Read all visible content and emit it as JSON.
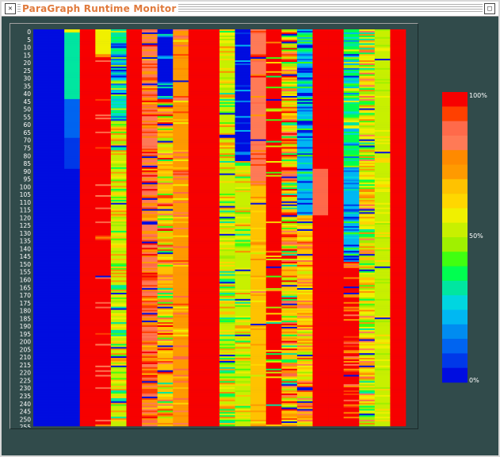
{
  "window": {
    "title": "ParaGraph Runtime Monitor",
    "close_glyph": "✕",
    "maximize_glyph": "□"
  },
  "chart_data": {
    "type": "heatmap",
    "title": "",
    "xlabel": "",
    "ylabel": "",
    "y_tick_labels": [
      "0",
      "5",
      "10",
      "15",
      "20",
      "25",
      "30",
      "35",
      "40",
      "45",
      "50",
      "55",
      "60",
      "65",
      "70",
      "75",
      "80",
      "85",
      "90",
      "95",
      "100",
      "105",
      "110",
      "115",
      "120",
      "125",
      "130",
      "135",
      "140",
      "145",
      "150",
      "155",
      "160",
      "165",
      "170",
      "175",
      "180",
      "185",
      "190",
      "195",
      "200",
      "205",
      "210",
      "215",
      "220",
      "225",
      "230",
      "235",
      "240",
      "245",
      "250",
      "255"
    ],
    "row_count": 256,
    "column_count": 20,
    "value_range": [
      0,
      100
    ],
    "unit": "%",
    "colorbar": {
      "labels": [
        "100%",
        "50%",
        "0%"
      ],
      "colors_top_to_bottom": [
        "#f70000",
        "#ff4000",
        "#ff6a4a",
        "#ff7a56",
        "#ff8a00",
        "#ff9a00",
        "#ffc200",
        "#ffd700",
        "#f0f000",
        "#c8f000",
        "#a0f000",
        "#40ff10",
        "#00ff50",
        "#00e6a0",
        "#00d6e0",
        "#00b8f2",
        "#008cf0",
        "#0064f0",
        "#0038e8",
        "#000de0"
      ]
    },
    "columns": [
      {
        "segments": [
          [
            0,
            256,
            0
          ]
        ]
      },
      {
        "segments": [
          [
            0,
            256,
            0
          ]
        ]
      },
      {
        "segments": [
          [
            0,
            2,
            60
          ],
          [
            2,
            45,
            30
          ],
          [
            45,
            70,
            10
          ],
          [
            70,
            90,
            5
          ],
          [
            90,
            256,
            0
          ]
        ]
      },
      {
        "segments": [
          [
            0,
            256,
            100
          ]
        ]
      },
      {
        "segments": [
          [
            0,
            16,
            60
          ],
          [
            16,
            18,
            80
          ],
          [
            18,
            30,
            100
          ],
          [
            30,
            70,
            100
          ],
          [
            70,
            256,
            100
          ]
        ],
        "noise": {
          "level": 90,
          "spread": 12,
          "rate": 0.15
        }
      },
      {
        "segments": [
          [
            0,
            60,
            30
          ],
          [
            60,
            256,
            55
          ]
        ],
        "noise": {
          "spread": 25,
          "rate": 0.7
        }
      },
      {
        "segments": [
          [
            0,
            256,
            100
          ]
        ]
      },
      {
        "segments": [
          [
            0,
            256,
            85
          ]
        ],
        "noise": {
          "spread": 15,
          "rate": 0.85
        }
      },
      {
        "segments": [
          [
            0,
            45,
            0
          ],
          [
            45,
            256,
            68
          ]
        ],
        "noise": {
          "spread": 35,
          "rate": 0.6
        }
      },
      {
        "segments": [
          [
            0,
            256,
            75
          ]
        ],
        "noise": {
          "spread": 20,
          "rate": 0.3
        }
      },
      {
        "segments": [
          [
            0,
            256,
            100
          ]
        ]
      },
      {
        "segments": [
          [
            0,
            256,
            100
          ]
        ]
      },
      {
        "segments": [
          [
            0,
            10,
            60
          ],
          [
            10,
            256,
            55
          ]
        ],
        "noise": {
          "spread": 25,
          "rate": 0.6
        }
      },
      {
        "segments": [
          [
            0,
            85,
            0
          ],
          [
            85,
            256,
            55
          ]
        ],
        "noise": {
          "spread": 25,
          "rate": 0.5
        }
      },
      {
        "segments": [
          [
            0,
            100,
            85
          ],
          [
            100,
            256,
            70
          ]
        ],
        "noise": {
          "spread": 15,
          "rate": 0.2
        }
      },
      {
        "segments": [
          [
            0,
            256,
            100
          ]
        ],
        "noise": {
          "level": 55,
          "spread": 25,
          "rate": 0.12
        }
      },
      {
        "segments": [
          [
            0,
            256,
            70
          ]
        ],
        "noise": {
          "spread": 40,
          "rate": 0.8
        }
      },
      {
        "segments": [
          [
            0,
            120,
            20
          ],
          [
            120,
            256,
            70
          ]
        ],
        "noise": {
          "spread": 25,
          "rate": 0.6
        }
      },
      {
        "segments": [
          [
            0,
            90,
            100
          ],
          [
            90,
            120,
            90
          ],
          [
            120,
            256,
            100
          ]
        ]
      },
      {
        "segments": [
          [
            0,
            256,
            100
          ]
        ]
      },
      {
        "segments": [
          [
            0,
            90,
            35
          ],
          [
            90,
            150,
            20
          ],
          [
            150,
            256,
            100
          ]
        ],
        "noise": {
          "spread": 25,
          "rate": 0.6
        }
      },
      {
        "segments": [
          [
            0,
            256,
            60
          ]
        ],
        "noise": {
          "spread": 30,
          "rate": 0.8
        }
      },
      {
        "segments": [
          [
            0,
            256,
            55
          ]
        ],
        "noise": {
          "spread": 10,
          "rate": 0.3
        }
      },
      {
        "segments": [
          [
            0,
            256,
            100
          ]
        ]
      }
    ]
  }
}
